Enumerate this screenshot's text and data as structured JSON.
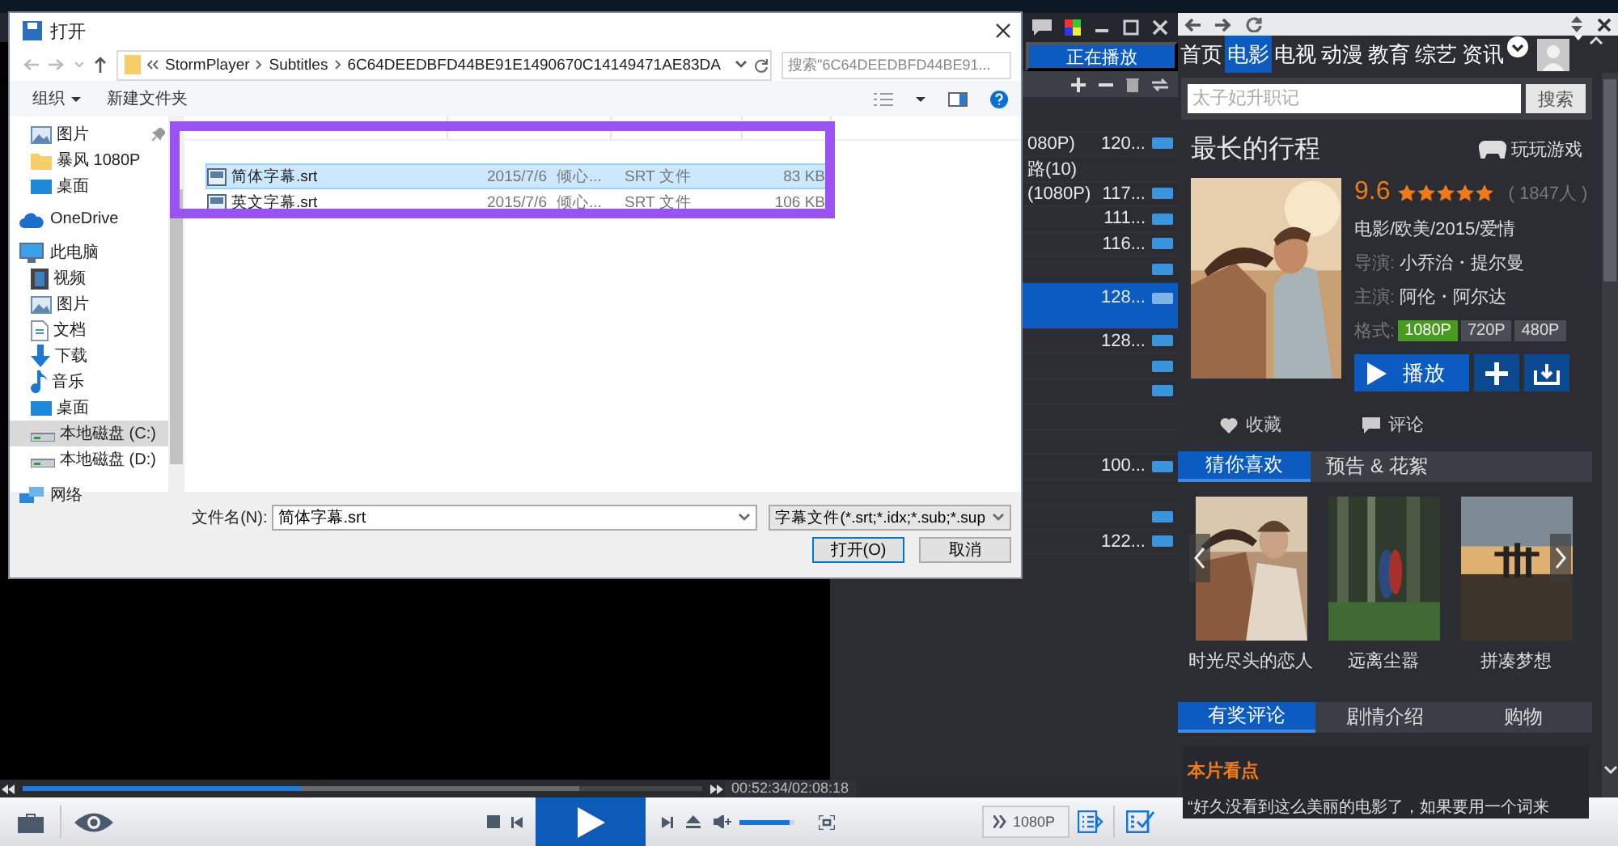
{
  "player": {
    "playlist": {
      "tab": "正在播放",
      "rows": [
        {
          "title": "",
          "size": "",
          "badge": false,
          "selected": false
        },
        {
          "title": "080P)",
          "size": "120...",
          "badge": true,
          "selected": false
        },
        {
          "title": "路(10)",
          "size": "",
          "badge": false,
          "selected": false
        },
        {
          "title": "(1080P)",
          "size": "117...",
          "badge": true,
          "selected": false
        },
        {
          "title": "",
          "size": "111...",
          "badge": true,
          "selected": false
        },
        {
          "title": "",
          "size": "116...",
          "badge": true,
          "selected": false
        },
        {
          "title": "",
          "size": "",
          "badge": true,
          "selected": false
        },
        {
          "title": "",
          "size": "128...",
          "badge": true,
          "selected": true
        },
        {
          "title": "",
          "size": "128...",
          "badge": true,
          "selected": false
        },
        {
          "title": "",
          "size": "",
          "badge": true,
          "selected": false
        },
        {
          "title": "",
          "size": "",
          "badge": true,
          "selected": false
        },
        {
          "title": "",
          "size": "",
          "badge": false,
          "selected": false
        },
        {
          "title": "",
          "size": "",
          "badge": false,
          "selected": false
        },
        {
          "title": "",
          "size": "100...",
          "badge": true,
          "selected": false
        },
        {
          "title": "",
          "size": "",
          "badge": false,
          "selected": false
        },
        {
          "title": "",
          "size": "",
          "badge": true,
          "selected": false
        },
        {
          "title": "",
          "size": "122...",
          "badge": true,
          "selected": false
        }
      ]
    },
    "seek": {
      "level": 0.41
    },
    "buffer": {
      "level": 0.82
    },
    "time": "00:52:34/02:08:18",
    "volume": {
      "level": 0.9
    },
    "quality": "1080P"
  },
  "panel": {
    "tabs": [
      {
        "label": "首页",
        "selected": false
      },
      {
        "label": "电影",
        "selected": true
      },
      {
        "label": "电视",
        "selected": false
      },
      {
        "label": "动漫",
        "selected": false
      },
      {
        "label": "教育",
        "selected": false
      },
      {
        "label": "综艺",
        "selected": false
      },
      {
        "label": "资讯",
        "selected": false
      }
    ],
    "search": {
      "placeholder": "太子妃升职记",
      "button": "搜索"
    },
    "title": "最长的行程",
    "game_link": "玩玩游戏",
    "rating": "9.6",
    "stars": 5,
    "votes": "( 1847人 )",
    "meta": "电影/欧美/2015/爱情",
    "credits": [
      {
        "label": "导演:",
        "value": "小乔治・提尔曼"
      },
      {
        "label": "主演:",
        "value": "阿伦・阿尔达"
      }
    ],
    "formats": {
      "label": "格式:",
      "options": [
        {
          "label": "1080P",
          "selected": true
        },
        {
          "label": "720P",
          "selected": false
        },
        {
          "label": "480P",
          "selected": false
        }
      ]
    },
    "play": "播放",
    "favorite": "收藏",
    "comment": "评论",
    "rec_tabs": [
      {
        "label": "猜你喜欢",
        "selected": true
      },
      {
        "label": "预告 & 花絮",
        "selected": false
      }
    ],
    "recommendations": [
      "时光尽头的恋人",
      "远离尘嚣",
      "拼凑梦想"
    ],
    "review_tabs": [
      {
        "label": "有奖评论",
        "selected": true
      },
      {
        "label": "剧情介绍",
        "selected": false
      },
      {
        "label": "购物",
        "selected": false
      }
    ],
    "highlights": {
      "title": "本片看点",
      "text": "“好久没看到这么美丽的电影了，如果要用一个词来"
    }
  },
  "dialog": {
    "title": "打开",
    "address": [
      "StormPlayer",
      "Subtitles",
      "6C64DEEDBFD44BE91E1490670C14149471AE83DA"
    ],
    "search": {
      "placeholder": "搜索\"6C64DEEDBFD44BE91..."
    },
    "toolbar": [
      {
        "label": "组织",
        "menu": true
      },
      {
        "label": "新建文件夹",
        "menu": false
      }
    ],
    "sidebar": {
      "pinned_items": [
        {
          "label": "图片",
          "kind": "pictures",
          "pinned": true,
          "selected": false
        },
        {
          "label": "暴风 1080P",
          "kind": "folder",
          "pinned": false,
          "selected": false
        },
        {
          "label": "桌面",
          "kind": "desktop",
          "pinned": false,
          "selected": false
        }
      ],
      "roots": [
        {
          "label": "OneDrive",
          "kind": "cloud",
          "selected": false
        },
        {
          "label": "此电脑",
          "kind": "computer",
          "selected": false,
          "children": [
            {
              "label": "视频",
              "kind": "videos",
              "selected": false
            },
            {
              "label": "图片",
              "kind": "pictures",
              "selected": false
            },
            {
              "label": "文档",
              "kind": "documents",
              "selected": false
            },
            {
              "label": "下载",
              "kind": "downloads",
              "selected": false
            },
            {
              "label": "音乐",
              "kind": "music",
              "selected": false
            },
            {
              "label": "桌面",
              "kind": "desktop",
              "selected": false
            },
            {
              "label": "本地磁盘 (C:)",
              "kind": "drive",
              "selected": true
            },
            {
              "label": "本地磁盘 (D:)",
              "kind": "drive",
              "selected": false
            }
          ]
        },
        {
          "label": "网络",
          "kind": "network",
          "selected": false
        }
      ]
    },
    "files": [
      {
        "name": "简体字幕.srt",
        "date": "2015/7/6",
        "time": "倾心...",
        "type": "SRT 文件",
        "size": "83 KB",
        "selected": true
      },
      {
        "name": "英文字幕.srt",
        "date": "2015/7/6",
        "time": "倾心...",
        "type": "SRT 文件",
        "size": "106 KB",
        "selected": false
      }
    ],
    "filename": {
      "label": "文件名(N):",
      "value": "简体字幕.srt"
    },
    "filter": "字幕文件(*.srt;*.idx;*.sub;*.sup",
    "buttons": [
      {
        "label": "打开(O)",
        "kind": "default"
      },
      {
        "label": "取消",
        "kind": "normal"
      }
    ]
  }
}
